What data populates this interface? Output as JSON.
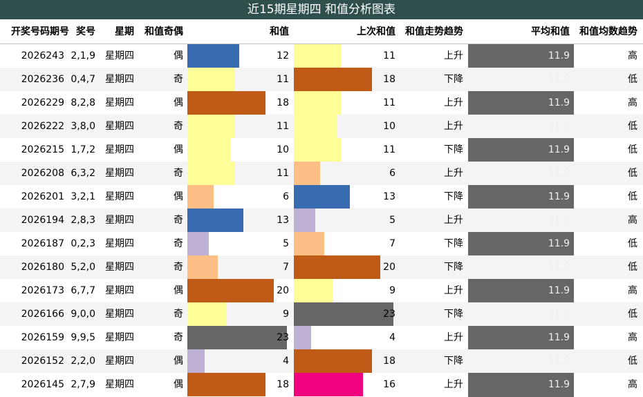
{
  "title": "近15期星期四 和值分析图表",
  "headers": {
    "issue": "开奖号码期号",
    "number": "奖号",
    "weekday": "星期",
    "parity": "和值奇偶",
    "sum": "和值",
    "prev_sum": "上次和值",
    "trend": "和值走势趋势",
    "avg": "平均和值",
    "avg_trend": "和值均数趋势"
  },
  "colors": {
    "header_bg": "#2e4f4b",
    "avg_bg": "#666666",
    "bar_4": "#bfb0d6",
    "bar_5": "#bfb0d6",
    "bar_6": "#fdbf86",
    "bar_7": "#fdbf86",
    "bar_9": "#fefe99",
    "bar_10": "#fefe99",
    "bar_11": "#fefe99",
    "bar_12": "#386cb0",
    "bar_13": "#386cb0",
    "bar_16": "#f0027f",
    "bar_18": "#bf5b16",
    "bar_20": "#bf5b16",
    "bar_23": "#666666"
  },
  "sum_scale_max": 23,
  "rows": [
    {
      "issue": "2026243",
      "number": "2,1,9",
      "weekday": "星期四",
      "parity": "偶",
      "sum": "12",
      "prev_sum": "11",
      "trend": "上升",
      "avg": "11.9",
      "avg_trend": "高"
    },
    {
      "issue": "2026236",
      "number": "0,4,7",
      "weekday": "星期四",
      "parity": "奇",
      "sum": "11",
      "prev_sum": "18",
      "trend": "下降",
      "avg": "11.9",
      "avg_trend": "低"
    },
    {
      "issue": "2026229",
      "number": "8,2,8",
      "weekday": "星期四",
      "parity": "偶",
      "sum": "18",
      "prev_sum": "11",
      "trend": "上升",
      "avg": "11.9",
      "avg_trend": "高"
    },
    {
      "issue": "2026222",
      "number": "3,8,0",
      "weekday": "星期四",
      "parity": "奇",
      "sum": "11",
      "prev_sum": "10",
      "trend": "上升",
      "avg": "11.9",
      "avg_trend": "低"
    },
    {
      "issue": "2026215",
      "number": "1,7,2",
      "weekday": "星期四",
      "parity": "偶",
      "sum": "10",
      "prev_sum": "11",
      "trend": "下降",
      "avg": "11.9",
      "avg_trend": "低"
    },
    {
      "issue": "2026208",
      "number": "6,3,2",
      "weekday": "星期四",
      "parity": "奇",
      "sum": "11",
      "prev_sum": "6",
      "trend": "上升",
      "avg": "11.9",
      "avg_trend": "低"
    },
    {
      "issue": "2026201",
      "number": "3,2,1",
      "weekday": "星期四",
      "parity": "偶",
      "sum": "6",
      "prev_sum": "13",
      "trend": "下降",
      "avg": "11.9",
      "avg_trend": "低"
    },
    {
      "issue": "2026194",
      "number": "2,8,3",
      "weekday": "星期四",
      "parity": "奇",
      "sum": "13",
      "prev_sum": "5",
      "trend": "上升",
      "avg": "11.9",
      "avg_trend": "高"
    },
    {
      "issue": "2026187",
      "number": "0,2,3",
      "weekday": "星期四",
      "parity": "奇",
      "sum": "5",
      "prev_sum": "7",
      "trend": "下降",
      "avg": "11.9",
      "avg_trend": "低"
    },
    {
      "issue": "2026180",
      "number": "5,2,0",
      "weekday": "星期四",
      "parity": "奇",
      "sum": "7",
      "prev_sum": "20",
      "trend": "下降",
      "avg": "11.9",
      "avg_trend": "低"
    },
    {
      "issue": "2026173",
      "number": "6,7,7",
      "weekday": "星期四",
      "parity": "偶",
      "sum": "20",
      "prev_sum": "9",
      "trend": "上升",
      "avg": "11.9",
      "avg_trend": "高"
    },
    {
      "issue": "2026166",
      "number": "9,0,0",
      "weekday": "星期四",
      "parity": "奇",
      "sum": "9",
      "prev_sum": "23",
      "trend": "下降",
      "avg": "11.9",
      "avg_trend": "低"
    },
    {
      "issue": "2026159",
      "number": "9,9,5",
      "weekday": "星期四",
      "parity": "奇",
      "sum": "23",
      "prev_sum": "4",
      "trend": "上升",
      "avg": "11.9",
      "avg_trend": "高"
    },
    {
      "issue": "2026152",
      "number": "2,2,0",
      "weekday": "星期四",
      "parity": "偶",
      "sum": "4",
      "prev_sum": "18",
      "trend": "下降",
      "avg": "11.9",
      "avg_trend": "低"
    },
    {
      "issue": "2026145",
      "number": "2,7,9",
      "weekday": "星期四",
      "parity": "偶",
      "sum": "18",
      "prev_sum": "16",
      "trend": "上升",
      "avg": "11.9",
      "avg_trend": "高"
    }
  ]
}
